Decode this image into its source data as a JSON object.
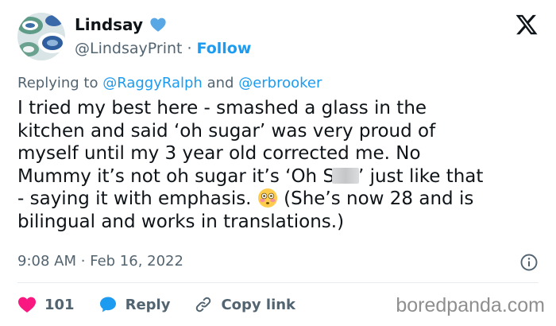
{
  "user": {
    "display_name": "Lindsay",
    "handle": "@LindsayPrint",
    "separator": "·",
    "follow_label": "Follow"
  },
  "platform_logo": "x-logo",
  "reply": {
    "prefix": "Replying to",
    "mention_1": "@RaggyRalph",
    "conjunction": "and",
    "mention_2": "@erbrooker"
  },
  "body": {
    "line_1": "I tried my best here - smashed a glass in the",
    "line_2": "kitchen and said ‘oh sugar’ was very proud of",
    "line_3": "myself until my 3 year old corrected me. No",
    "line_4_before": "Mummy it’s not oh sugar it’s ‘Oh S",
    "line_4_after": "’ just like that",
    "line_5_before": "- saying it with emphasis.",
    "line_5_after": "(She’s now 28 and is",
    "line_6": "bilingual and works in translations.)"
  },
  "meta": {
    "time": "9:08 AM",
    "separator": "·",
    "date": "Feb 16, 2022"
  },
  "actions": {
    "like_count": "101",
    "reply_label": "Reply",
    "copy_link_label": "Copy link"
  },
  "watermark": "boredpanda.com",
  "colors": {
    "accent": "#1d9bf0",
    "like": "#f91880",
    "text": "#0f1419",
    "secondary": "#536471"
  }
}
